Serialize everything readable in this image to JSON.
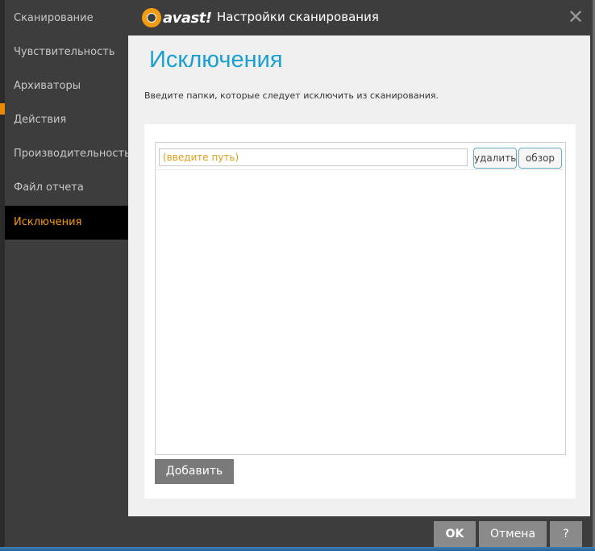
{
  "window": {
    "brand": "avast!",
    "title": "Настройки сканирования"
  },
  "sidebar": {
    "items": [
      {
        "label": "Сканирование"
      },
      {
        "label": "Чувствительность"
      },
      {
        "label": "Архиваторы"
      },
      {
        "label": "Действия"
      },
      {
        "label": "Производительность"
      },
      {
        "label": "Файл отчета"
      },
      {
        "label": "Исключения",
        "active": true
      }
    ]
  },
  "main": {
    "title": "Исключения",
    "description": "Введите папки, которые следует исключить из сканирования.",
    "path_placeholder": "(введите путь)",
    "delete_label": "удалить",
    "browse_label": "обзор",
    "add_label": "Добавить"
  },
  "footer": {
    "ok_label": "OK",
    "cancel_label": "Отмена",
    "help_label": "?"
  },
  "colors": {
    "accent": "#f39c12",
    "title_blue": "#1aa0d0",
    "placeholder": "#e0a020"
  }
}
